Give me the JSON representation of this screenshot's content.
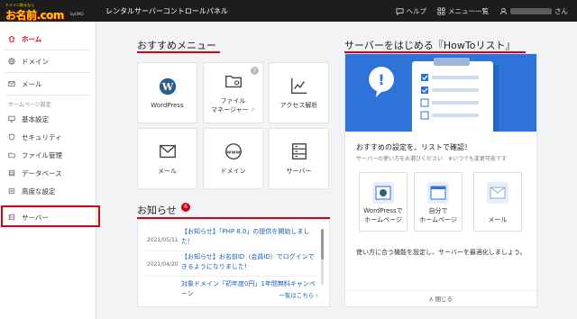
{
  "header": {
    "logo_small": "ドメイン取るなら",
    "logo_main": "お名前.com",
    "logo_sub": "byGMO",
    "title": "レンタルサーバーコントロールパネル",
    "help": "ヘルプ",
    "menu_list": "メニュー一覧",
    "user_suffix": "さん"
  },
  "sidebar": {
    "items": [
      {
        "label": "ホーム",
        "icon": "home-icon"
      },
      {
        "label": "ドメイン",
        "icon": "globe-icon"
      },
      {
        "label": "メール",
        "icon": "mail-icon"
      }
    ],
    "section_label": "ホームページ設定",
    "settings": [
      {
        "label": "基本設定",
        "icon": "monitor-icon"
      },
      {
        "label": "セキュリティ",
        "icon": "shield-icon"
      },
      {
        "label": "ファイル管理",
        "icon": "folder-icon"
      },
      {
        "label": "データベース",
        "icon": "database-icon"
      },
      {
        "label": "高度な設定",
        "icon": "settings-icon"
      }
    ],
    "server_label": "サーバー"
  },
  "recommended": {
    "title": "おすすめメニュー",
    "tiles": [
      {
        "label": "WordPress"
      },
      {
        "label_line1": "ファイル",
        "label_line2": "マネージャー",
        "help": "?",
        "external": "↗"
      },
      {
        "label": "アクセス解析"
      },
      {
        "label": "メール"
      },
      {
        "label": "ドメイン"
      },
      {
        "label": "サーバー"
      }
    ]
  },
  "news": {
    "title": "お知らせ",
    "badge": "6",
    "items": [
      {
        "date": "2021/05/11",
        "text": "【お知らせ】「PHP 8.0」の提供を開始しました！"
      },
      {
        "date": "2021/04/20",
        "text": "【お知らせ】お名前ID（会員ID）でログインできるようになりました！"
      },
      {
        "date": "",
        "text": "対象ドメイン「初年度0円」1年間無料キャンペーン"
      }
    ],
    "more": "一覧はこちら ›"
  },
  "howto": {
    "title": "サーバーをはじめる『HowToリスト』",
    "confirm": "おすすめの設定を、リストで確認！",
    "sub": "サーバーの使い方をお選びください　※いつでも変更可能です",
    "options": [
      {
        "line1": "WordPressで",
        "line2": "ホームページ"
      },
      {
        "line1": "自分で",
        "line2": "ホームページ"
      },
      {
        "line1": "メール",
        "line2": ""
      }
    ],
    "usage": "使い方に合う機能を設定し、サーバーを最適化しましょう。",
    "close": "∧ 閉じる"
  },
  "colors": {
    "accent": "#d0021b",
    "link": "#1a5fb4",
    "hero": "#2d73d8"
  }
}
